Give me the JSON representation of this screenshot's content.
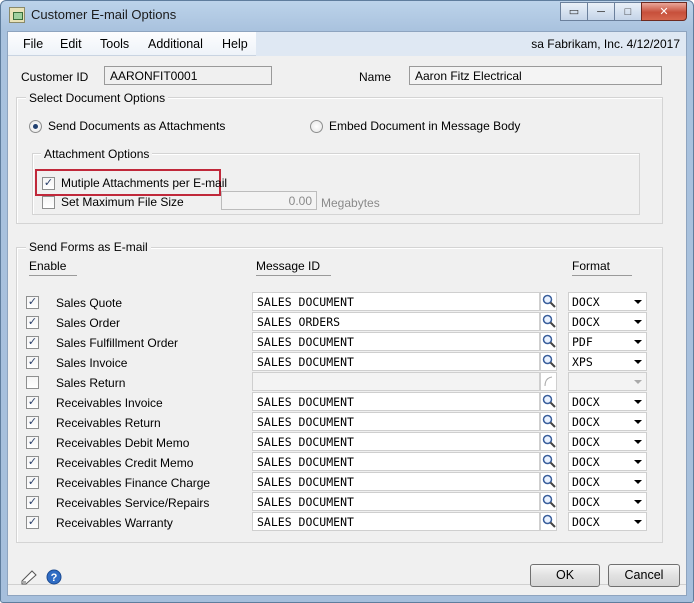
{
  "window": {
    "title": "Customer E-mail Options"
  },
  "menu": {
    "items": [
      "File",
      "Edit",
      "Tools",
      "Additional",
      "Help"
    ],
    "sysinfo": "sa  Fabrikam, Inc.  4/12/2017"
  },
  "customer": {
    "id_label": "Customer ID",
    "id_value": "AARONFIT0001",
    "name_label": "Name",
    "name_value": "Aaron Fitz Electrical"
  },
  "document_options": {
    "group_label": "Select Document Options",
    "send_attachments_label": "Send Documents as Attachments",
    "send_attachments_selected": true,
    "embed_label": "Embed Document in Message Body",
    "embed_selected": false,
    "attachment_group_label": "Attachment Options",
    "multiple_label": "Mutiple Attachments per E-mail",
    "multiple_checked": true,
    "maxsize_label": "Set Maximum File Size",
    "maxsize_checked": false,
    "maxsize_value": "0.00",
    "maxsize_unit": "Megabytes"
  },
  "forms": {
    "group_label": "Send Forms as E-mail",
    "col_enable": "Enable",
    "col_message": "Message ID",
    "col_format": "Format",
    "rows": [
      {
        "name": "Sales Quote",
        "enabled": true,
        "message": "SALES DOCUMENT",
        "format": "DOCX"
      },
      {
        "name": "Sales Order",
        "enabled": true,
        "message": "SALES ORDERS",
        "format": "DOCX"
      },
      {
        "name": "Sales Fulfillment Order",
        "enabled": true,
        "message": "SALES DOCUMENT",
        "format": "PDF"
      },
      {
        "name": "Sales Invoice",
        "enabled": true,
        "message": "SALES DOCUMENT",
        "format": "XPS"
      },
      {
        "name": "Sales Return",
        "enabled": false,
        "message": "",
        "format": ""
      },
      {
        "name": "Receivables Invoice",
        "enabled": true,
        "message": "SALES DOCUMENT",
        "format": "DOCX"
      },
      {
        "name": "Receivables Return",
        "enabled": true,
        "message": "SALES DOCUMENT",
        "format": "DOCX"
      },
      {
        "name": "Receivables Debit Memo",
        "enabled": true,
        "message": "SALES DOCUMENT",
        "format": "DOCX"
      },
      {
        "name": "Receivables Credit Memo",
        "enabled": true,
        "message": "SALES DOCUMENT",
        "format": "DOCX"
      },
      {
        "name": "Receivables Finance Charge",
        "enabled": true,
        "message": "SALES DOCUMENT",
        "format": "DOCX"
      },
      {
        "name": "Receivables Service/Repairs",
        "enabled": true,
        "message": "SALES DOCUMENT",
        "format": "DOCX"
      },
      {
        "name": "Receivables Warranty",
        "enabled": true,
        "message": "SALES DOCUMENT",
        "format": "DOCX"
      }
    ]
  },
  "buttons": {
    "ok": "OK",
    "cancel": "Cancel"
  },
  "icons": {
    "note": "note-icon",
    "help": "help-icon",
    "lookup": "lookup-icon"
  },
  "colors": {
    "highlight_box": "#c0283a",
    "check": "#2a3f6a"
  }
}
